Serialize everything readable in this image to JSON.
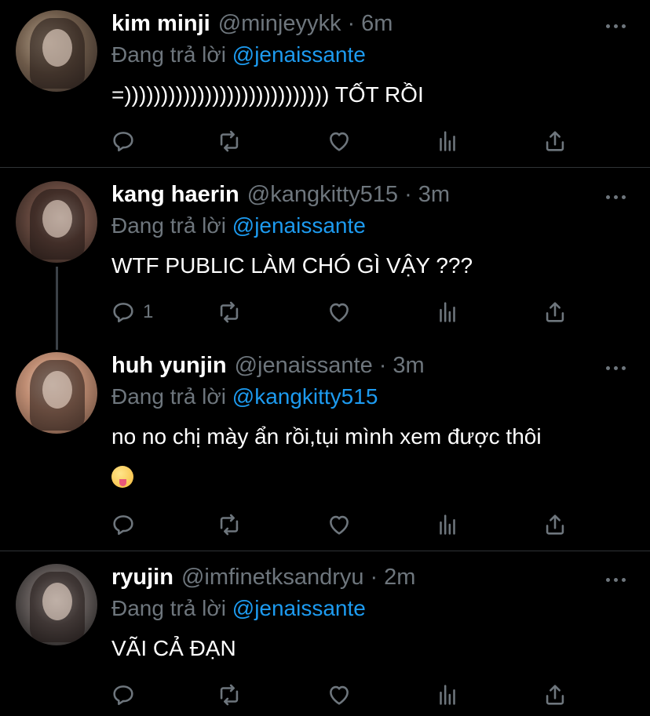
{
  "tweets": [
    {
      "name": "kim minji",
      "handle": "@minjeyykk",
      "time": "6m",
      "reply_prefix": "Đang trả lời",
      "reply_to": "@jenaissante",
      "text": "=)))))))))))))))))))))))))))) TỐT RỒI",
      "reply_count": ""
    },
    {
      "name": "kang haerin",
      "handle": "@kangkitty515",
      "time": "3m",
      "reply_prefix": "Đang trả lời",
      "reply_to": "@jenaissante",
      "text": "WTF PUBLIC LÀM CHÓ GÌ VẬY ???",
      "reply_count": "1"
    },
    {
      "name": "huh yunjin",
      "handle": "@jenaissante",
      "time": "3m",
      "reply_prefix": "Đang trả lời",
      "reply_to": "@kangkitty515",
      "text": "no no chị mày ẩn rồi,tụi mình xem được thôi",
      "emoji": "squinting-tongue-emoji",
      "reply_count": ""
    },
    {
      "name": "ryujin",
      "handle": "@imfinetksandryu",
      "time": "2m",
      "reply_prefix": "Đang trả lời",
      "reply_to": "@jenaissante",
      "text": "VÃI CẢ ĐẠN",
      "reply_count": ""
    }
  ],
  "separator": "·",
  "icons": [
    "reply-icon",
    "retweet-icon",
    "like-icon",
    "analytics-icon",
    "share-icon",
    "more-icon"
  ],
  "colors": {
    "background": "#000000",
    "text": "#ffffff",
    "secondary": "#6e767d",
    "link": "#1d9bf0"
  }
}
